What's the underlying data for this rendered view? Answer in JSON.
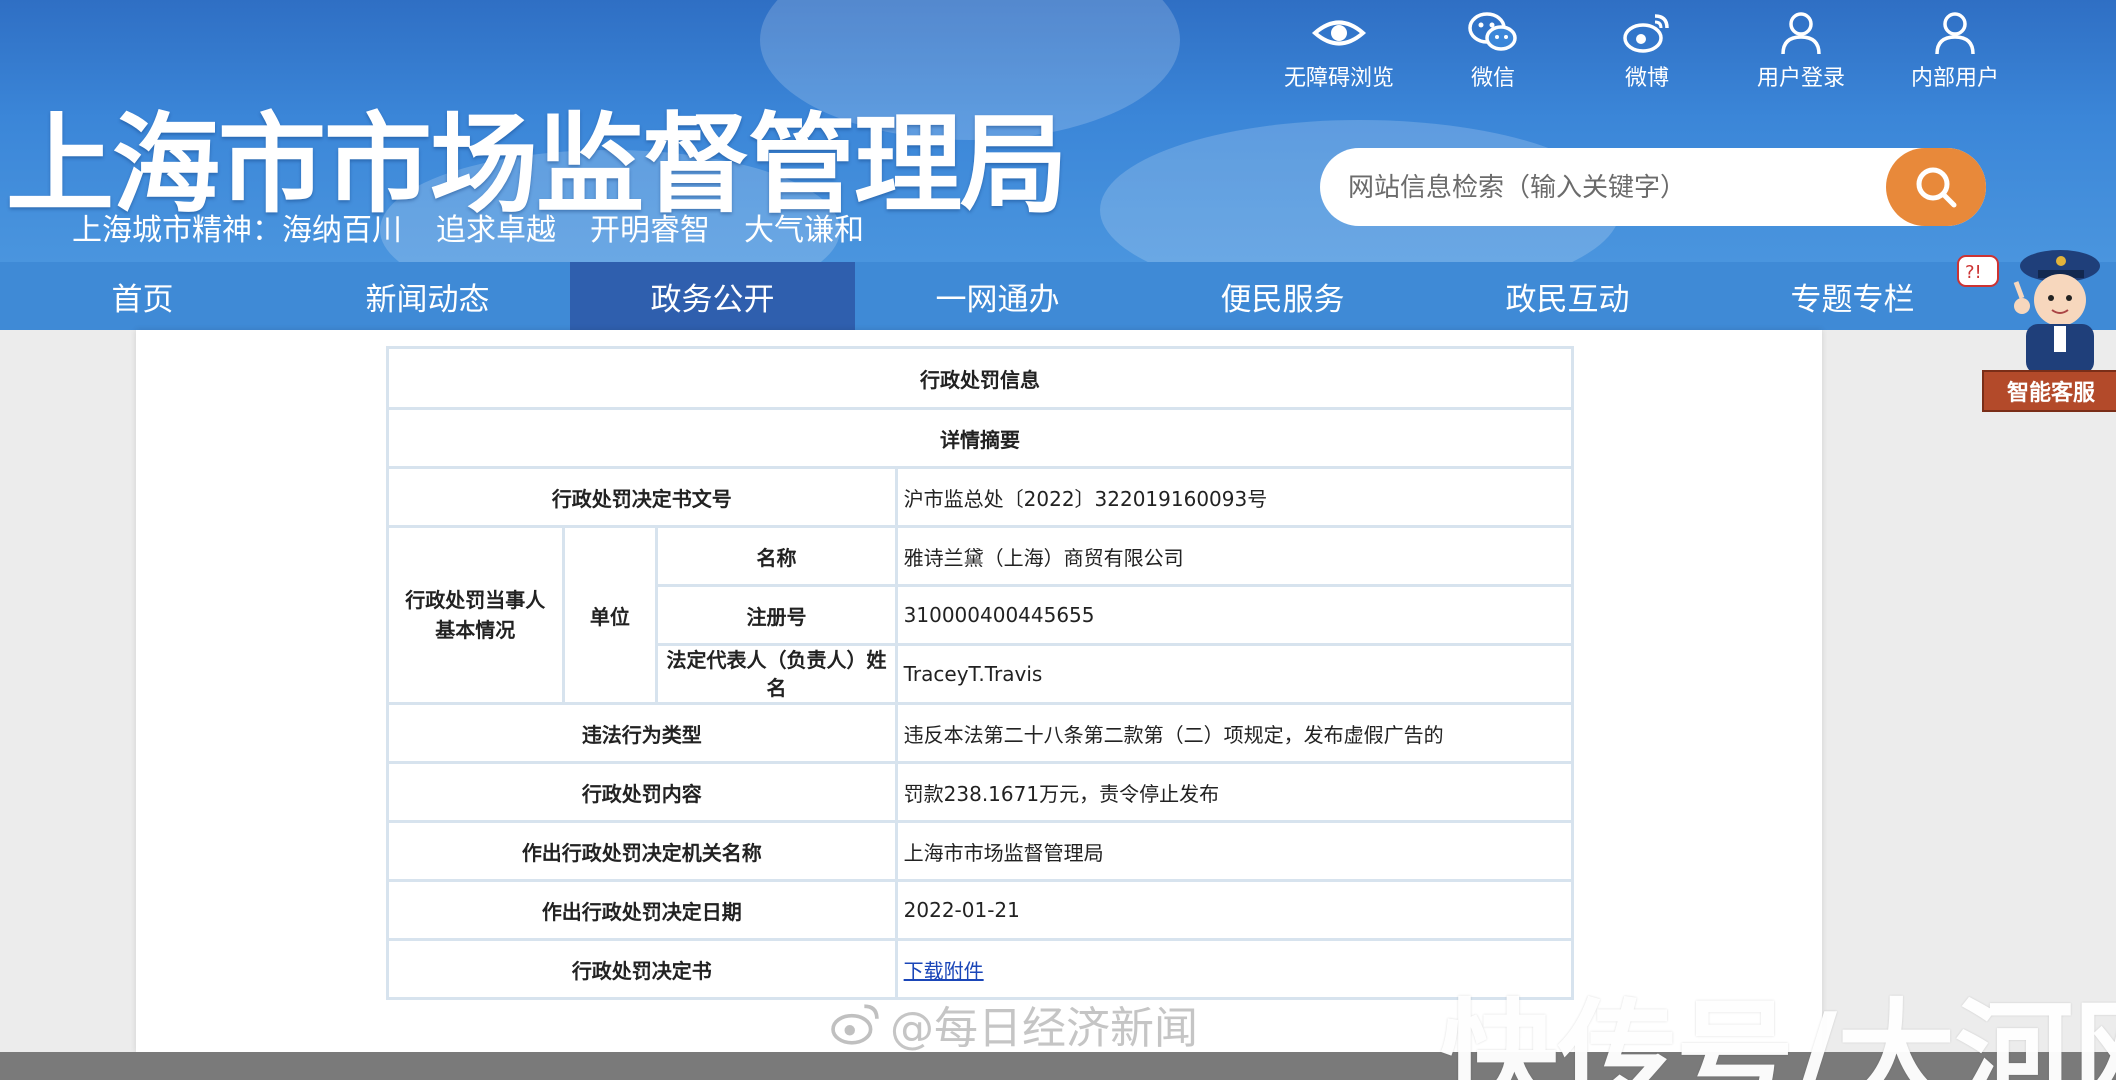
{
  "header": {
    "site_title": "上海市市场监督管理局",
    "slogan": [
      "上海城市精神：海纳百川",
      "追求卓越",
      "开明睿智",
      "大气谦和"
    ],
    "top_icons": [
      {
        "label": "无障碍浏览",
        "icon": "eye-icon"
      },
      {
        "label": "微信",
        "icon": "wechat-icon"
      },
      {
        "label": "微博",
        "icon": "weibo-icon"
      },
      {
        "label": "用户登录",
        "icon": "user-icon"
      },
      {
        "label": "内部用户",
        "icon": "user-icon"
      }
    ],
    "search": {
      "placeholder": "网站信息检索（输入关键字）"
    },
    "colors": {
      "header_blue": "#3b86d8",
      "nav_active": "#2f5fae",
      "search_button": "#e8893a"
    }
  },
  "nav": {
    "items": [
      "首页",
      "新闻动态",
      "政务公开",
      "一网通办",
      "便民服务",
      "政民互动",
      "专题专栏"
    ],
    "active": "政务公开"
  },
  "customer_service": {
    "label": "智能客服"
  },
  "table": {
    "title": "行政处罚信息",
    "summary": "详情摘要",
    "doc_no_label": "行政处罚决定书文号",
    "doc_no": "沪市监总处〔2022〕322019160093号",
    "party_label": "行政处罚当事人基本情况",
    "unit_label": "单位",
    "name_label": "名称",
    "name": "雅诗兰黛（上海）商贸有限公司",
    "reg_label": "注册号",
    "reg_no": "310000400445655",
    "rep_label": "法定代表人（负责人）姓名",
    "rep": "TraceyT.Travis",
    "violation_label": "违法行为类型",
    "violation": "违反本法第二十八条第二款第（二）项规定，发布虚假广告的",
    "penalty_label": "行政处罚内容",
    "penalty": "罚款238.1671万元，责令停止发布",
    "authority_label": "作出行政处罚决定机关名称",
    "authority": "上海市市场监督管理局",
    "date_label": "作出行政处罚决定日期",
    "date": "2022-01-21",
    "decision_label": "行政处罚决定书",
    "decision_link": "下载附件"
  },
  "watermarks": {
    "left": "@每日经济新闻",
    "right": "快传号/大河网"
  }
}
